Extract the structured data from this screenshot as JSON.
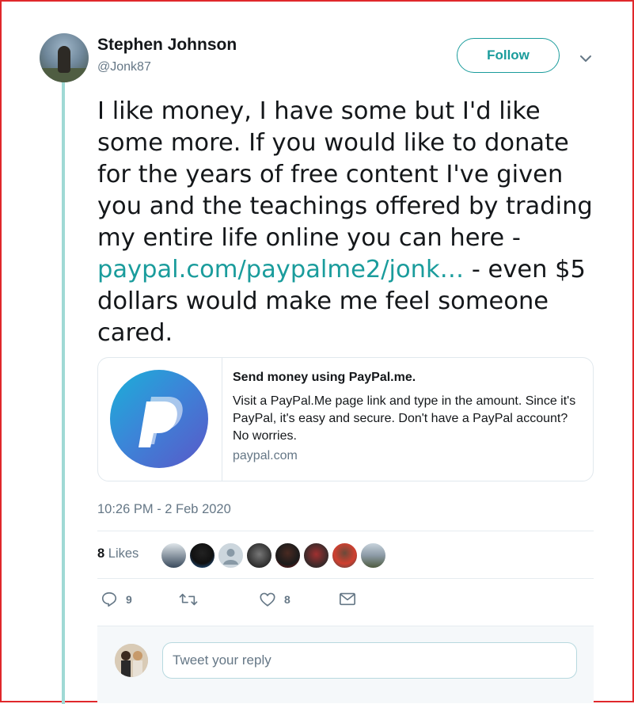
{
  "author": {
    "name": "Stephen Johnson",
    "handle": "@Jonk87",
    "follow_label": "Follow"
  },
  "tweet": {
    "text_before_link": "I like money, I have some but I'd like some more. If you would like to donate for the years of free content I've given you and the teachings offered by trading my entire life online you can here - ",
    "link_text": "paypal.com/paypalme2/jonk…",
    "text_after_link": " - even $5 dollars would make me feel someone cared.",
    "timestamp": "10:26 PM - 2 Feb 2020"
  },
  "card": {
    "title": "Send money using PayPal.me.",
    "description": "Visit a PayPal.Me page link and type in the amount. Since it's PayPal, it's easy and secure. Don't have a PayPal account? No worries.",
    "domain": "paypal.com",
    "icon": "paypal-logo"
  },
  "likes": {
    "count": "8",
    "label": "Likes",
    "avatar_count": 8
  },
  "actions": {
    "reply_count": "9",
    "retweet_count": "",
    "like_count": "8",
    "icons": [
      "reply-icon",
      "retweet-icon",
      "heart-icon",
      "message-icon"
    ]
  },
  "reply": {
    "placeholder": "Tweet your reply"
  },
  "colors": {
    "accent": "#1a9c9c",
    "thread_line": "#9fd9d5",
    "muted": "#657786",
    "frame_border": "#e0282b"
  }
}
